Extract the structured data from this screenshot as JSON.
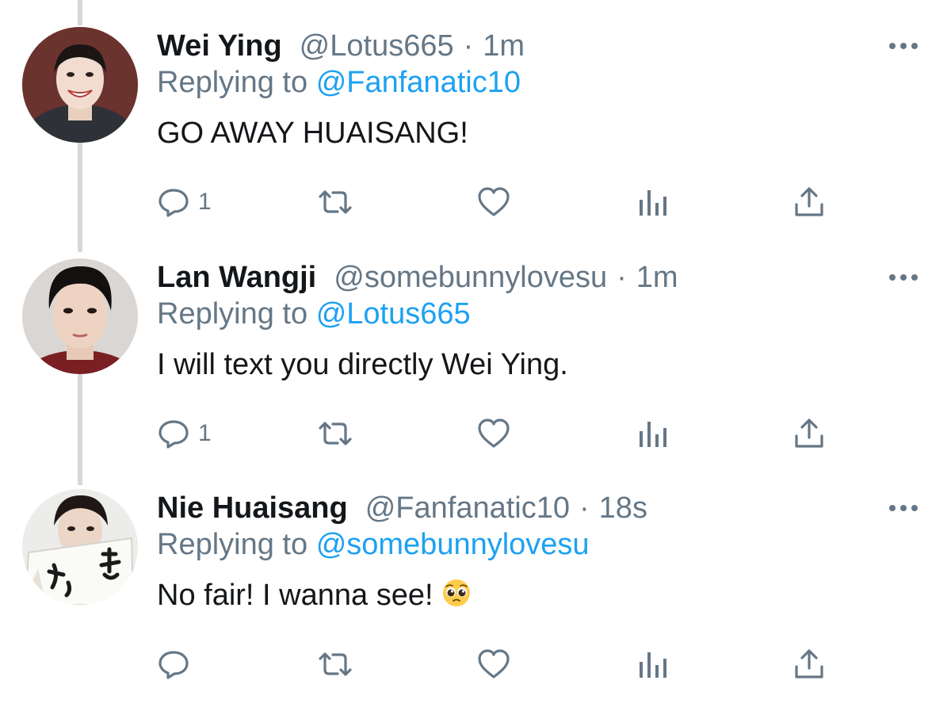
{
  "tweets": [
    {
      "name": "Wei Ying",
      "handle": "@Lotus665",
      "separator": "·",
      "time": "1m",
      "reply_prefix": "Replying to",
      "reply_target": "@Fanfanatic10",
      "text": "GO AWAY HUAISANG!",
      "reply_count": "1",
      "avatar_icon": "avatar-photo-wei-ying"
    },
    {
      "name": "Lan Wangji",
      "handle": "@somebunnylovesu",
      "separator": "·",
      "time": "1m",
      "reply_prefix": "Replying to",
      "reply_target": "@Lotus665",
      "text": "I will text you directly Wei Ying.",
      "reply_count": "1",
      "avatar_icon": "avatar-photo-lan-wangji"
    },
    {
      "name": "Nie Huaisang",
      "handle": "@Fanfanatic10",
      "separator": "·",
      "time": "18s",
      "reply_prefix": "Replying to",
      "reply_target": "@somebunnylovesu",
      "text": "No fair! I wanna see!",
      "reply_count": "",
      "emoji": "pleading-face",
      "avatar_icon": "avatar-photo-nie-huaisang"
    }
  ],
  "icons": {
    "reply": "reply-bubble-icon",
    "retweet": "retweet-icon",
    "like": "heart-icon",
    "analytics": "analytics-bars-icon",
    "share": "share-upload-icon",
    "more": "more-dots-icon"
  },
  "colors": {
    "text": "#14171a",
    "secondary": "#657786",
    "link": "#1da1f2",
    "thread_line": "#d4d8db"
  }
}
